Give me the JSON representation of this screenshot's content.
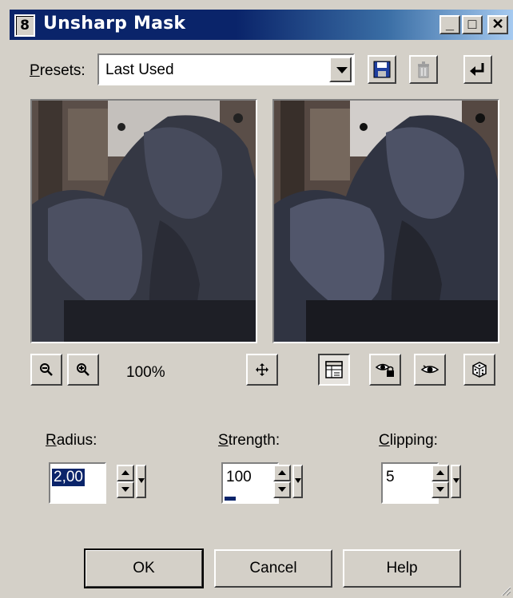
{
  "window": {
    "title": "Unsharp Mask",
    "app_icon_text": "8"
  },
  "titlebar_buttons": {
    "minimize": "_",
    "maximize": "□",
    "close": "✕"
  },
  "presets": {
    "label_accel": "P",
    "label_rest": "resets:",
    "value": "Last Used"
  },
  "zoom": {
    "level": "100%"
  },
  "params": {
    "radius": {
      "label_accel": "R",
      "label_rest": "adius:",
      "value": "2,00"
    },
    "strength": {
      "label_accel": "S",
      "label_rest": "trength:",
      "value": "100",
      "bar_fraction": 0.1
    },
    "clipping": {
      "label_accel": "C",
      "label_rest": "lipping:",
      "value": "5"
    }
  },
  "buttons": {
    "ok": "OK",
    "cancel": "Cancel",
    "help": "Help"
  },
  "colors": {
    "title_start": "#0a246a",
    "title_end": "#a6caf0",
    "face": "#d4d0c8",
    "selection": "#0a246a"
  }
}
